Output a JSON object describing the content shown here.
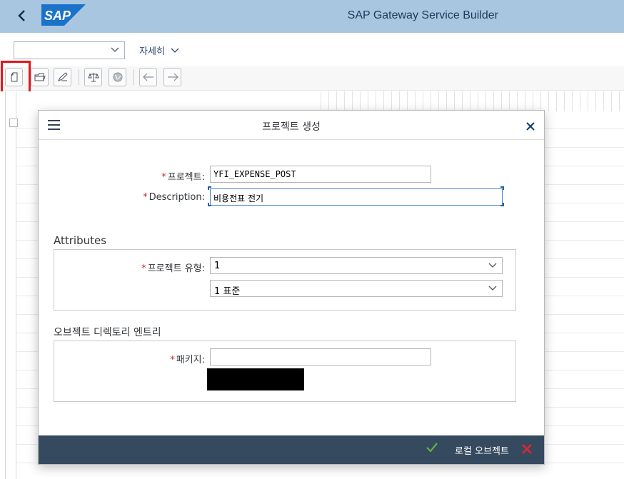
{
  "shell": {
    "back": "‹",
    "logo": "SAP",
    "title": "SAP Gateway Service Builder"
  },
  "subheader": {
    "command_value": "",
    "details_label": "자세히",
    "details_chevron": "∨"
  },
  "toolbar": {
    "buttons": [
      "new-icon",
      "open-icon",
      "edit-icon",
      "check-icon",
      "globe-icon",
      "arrow-left-icon",
      "arrow-right-icon"
    ]
  },
  "dialog": {
    "title": "프로젝트 생성",
    "fields": {
      "project_label": "프로젝트:",
      "project_value": "YFI_EXPENSE_POST",
      "description_label": "Description:",
      "description_value": "비용전표 전기"
    },
    "attributes": {
      "title": "Attributes",
      "type_label": "프로젝트 유형:",
      "type_value": "1",
      "type_text_value": "1 표준"
    },
    "directory": {
      "title": "오브젝트 디렉토리 엔트리",
      "package_label": "패키지:",
      "package_value": ""
    },
    "footer": {
      "local_object_label": "로컬 오브젝트"
    }
  },
  "colors": {
    "shell_bg": "#a9c6e0",
    "footer_bg": "#354a5f",
    "required": "#d8262c",
    "highlight": "#e8141a",
    "ok": "#63b340",
    "cancel": "#e2262c"
  }
}
